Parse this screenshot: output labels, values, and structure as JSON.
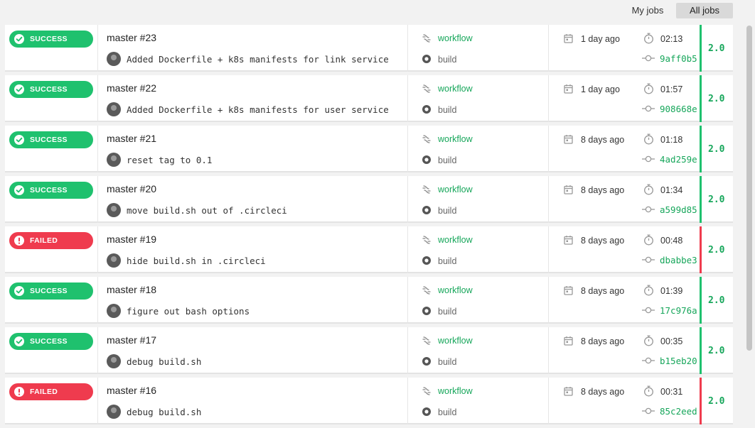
{
  "filters": {
    "my_jobs": "My jobs",
    "all_jobs": "All jobs"
  },
  "colors": {
    "success": "#1fc16e",
    "failed": "#ef3b4e",
    "link": "#16a65a"
  },
  "icons": {
    "success": "check-circle-icon",
    "failed": "exclamation-circle-icon",
    "workflow": "workflow-icon",
    "job": "job-icon",
    "date": "calendar-icon",
    "duration": "stopwatch-icon",
    "commit": "commit-icon"
  },
  "jobs": [
    {
      "status": "SUCCESS",
      "title": "master #23",
      "message": "Added Dockerfile + k8s manifests for link service",
      "workflow": "workflow",
      "job": "build",
      "ago": "1 day ago",
      "duration": "02:13",
      "sha": "9aff0b5",
      "version": "2.0"
    },
    {
      "status": "SUCCESS",
      "title": "master #22",
      "message": "Added Dockerfile + k8s manifests for user service",
      "workflow": "workflow",
      "job": "build",
      "ago": "1 day ago",
      "duration": "01:57",
      "sha": "908668e",
      "version": "2.0"
    },
    {
      "status": "SUCCESS",
      "title": "master #21",
      "message": "reset tag to 0.1",
      "workflow": "workflow",
      "job": "build",
      "ago": "8 days ago",
      "duration": "01:18",
      "sha": "4ad259e",
      "version": "2.0"
    },
    {
      "status": "SUCCESS",
      "title": "master #20",
      "message": "move build.sh out of .circleci",
      "workflow": "workflow",
      "job": "build",
      "ago": "8 days ago",
      "duration": "01:34",
      "sha": "a599d85",
      "version": "2.0"
    },
    {
      "status": "FAILED",
      "title": "master #19",
      "message": "hide build.sh in .circleci",
      "workflow": "workflow",
      "job": "build",
      "ago": "8 days ago",
      "duration": "00:48",
      "sha": "dbabbe3",
      "version": "2.0"
    },
    {
      "status": "SUCCESS",
      "title": "master #18",
      "message": "figure out bash options",
      "workflow": "workflow",
      "job": "build",
      "ago": "8 days ago",
      "duration": "01:39",
      "sha": "17c976a",
      "version": "2.0"
    },
    {
      "status": "SUCCESS",
      "title": "master #17",
      "message": "debug build.sh",
      "workflow": "workflow",
      "job": "build",
      "ago": "8 days ago",
      "duration": "00:35",
      "sha": "b15eb20",
      "version": "2.0"
    },
    {
      "status": "FAILED",
      "title": "master #16",
      "message": "debug build.sh",
      "workflow": "workflow",
      "job": "build",
      "ago": "8 days ago",
      "duration": "00:31",
      "sha": "85c2eed",
      "version": "2.0"
    }
  ]
}
